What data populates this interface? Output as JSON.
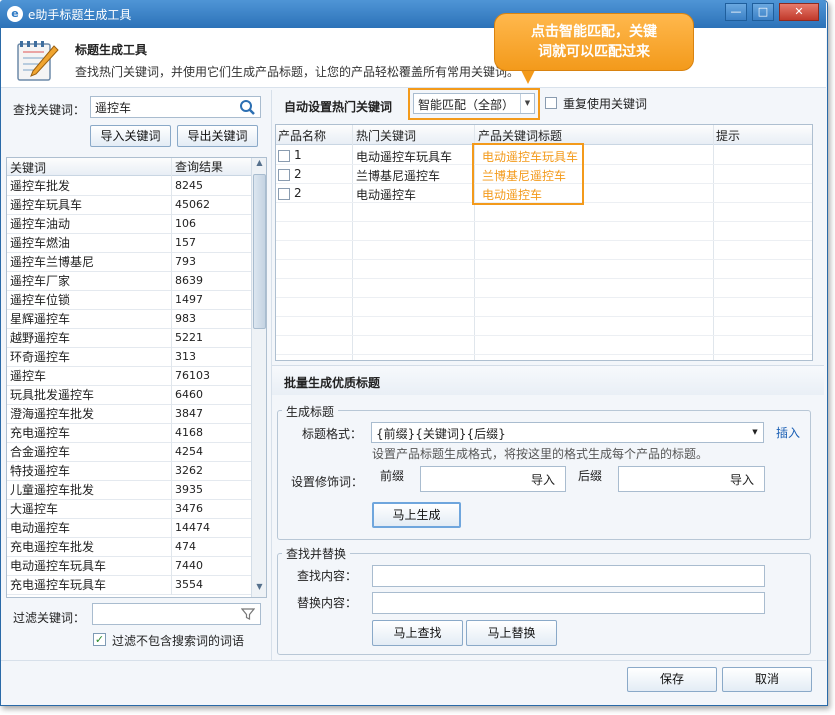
{
  "window": {
    "title": "e助手标题生成工具",
    "icon_glyph": "e",
    "controls": {
      "minimize": "—",
      "maximize": "□",
      "close": "✕"
    }
  },
  "header": {
    "title": "标题生成工具",
    "description": "查找热门关键词，并使用它们生成产品标题，让您的产品轻松覆盖所有常用关键词。"
  },
  "callout": {
    "line1": "点击智能匹配，关键",
    "line2": "词就可以匹配过来"
  },
  "left": {
    "search_label": "查找关键词：",
    "search_value": "遥控车",
    "import_button": "导入关键词",
    "export_button": "导出关键词",
    "columns": [
      "关键词",
      "查询结果"
    ],
    "rows": [
      [
        "遥控车批发",
        "8245"
      ],
      [
        "遥控车玩具车",
        "45062"
      ],
      [
        "遥控车油动",
        "106"
      ],
      [
        "遥控车燃油",
        "157"
      ],
      [
        "遥控车兰博基尼",
        "793"
      ],
      [
        "遥控车厂家",
        "8639"
      ],
      [
        "遥控车位锁",
        "1497"
      ],
      [
        "星辉遥控车",
        "983"
      ],
      [
        "越野遥控车",
        "5221"
      ],
      [
        "环奇遥控车",
        "313"
      ],
      [
        "遥控车",
        "76103"
      ],
      [
        "玩具批发遥控车",
        "6460"
      ],
      [
        "澄海遥控车批发",
        "3847"
      ],
      [
        "充电遥控车",
        "4168"
      ],
      [
        "合金遥控车",
        "4254"
      ],
      [
        "特技遥控车",
        "3262"
      ],
      [
        "儿童遥控车批发",
        "3935"
      ],
      [
        "大遥控车",
        "3476"
      ],
      [
        "电动遥控车",
        "14474"
      ],
      [
        "充电遥控车批发",
        "474"
      ],
      [
        "电动遥控车玩具车",
        "7440"
      ],
      [
        "充电遥控车玩具车",
        "3554"
      ]
    ],
    "filter_label": "过滤关键词：",
    "filter_value": "",
    "filter_checkbox_label": "过滤不包含搜索词的词语",
    "filter_checked": true
  },
  "auto": {
    "label": "自动设置热门关键词",
    "match_select": "智能匹配（全部）",
    "repeat_label": "重复使用关键词",
    "repeat_checked": false,
    "columns": [
      "产品名称",
      "热门关键词",
      "产品关键词标题",
      "提示"
    ],
    "rows": [
      {
        "name": "1",
        "keyword": "电动遥控车玩具车",
        "title": "电动遥控车玩具车",
        "tip": ""
      },
      {
        "name": "2",
        "keyword": "兰博基尼遥控车",
        "title": "兰博基尼遥控车",
        "tip": ""
      },
      {
        "name": "2",
        "keyword": "电动遥控车",
        "title": "电动遥控车",
        "tip": ""
      }
    ]
  },
  "batch": {
    "title": "批量生成优质标题",
    "group_title": "生成标题",
    "format_label": "标题格式：",
    "format_value": "{前缀}{关键词}{后缀}",
    "insert_link": "插入",
    "format_hint": "设置产品标题生成格式，将按这里的格式生成每个产品的标题。",
    "modifier_label": "设置修饰词：",
    "prefix_label": "前缀",
    "suffix_label": "后缀",
    "import_label": "导入",
    "generate_button": "马上生成"
  },
  "replace": {
    "group_title": "查找并替换",
    "find_label": "查找内容：",
    "replace_label": "替换内容：",
    "find_value": "",
    "replace_value": "",
    "find_button": "马上查找",
    "replace_button": "马上替换"
  },
  "footer": {
    "save_button": "保存",
    "cancel_button": "取消"
  },
  "colors": {
    "accent_orange": "#f39a1b",
    "titlebar_blue": "#2c72b8"
  }
}
